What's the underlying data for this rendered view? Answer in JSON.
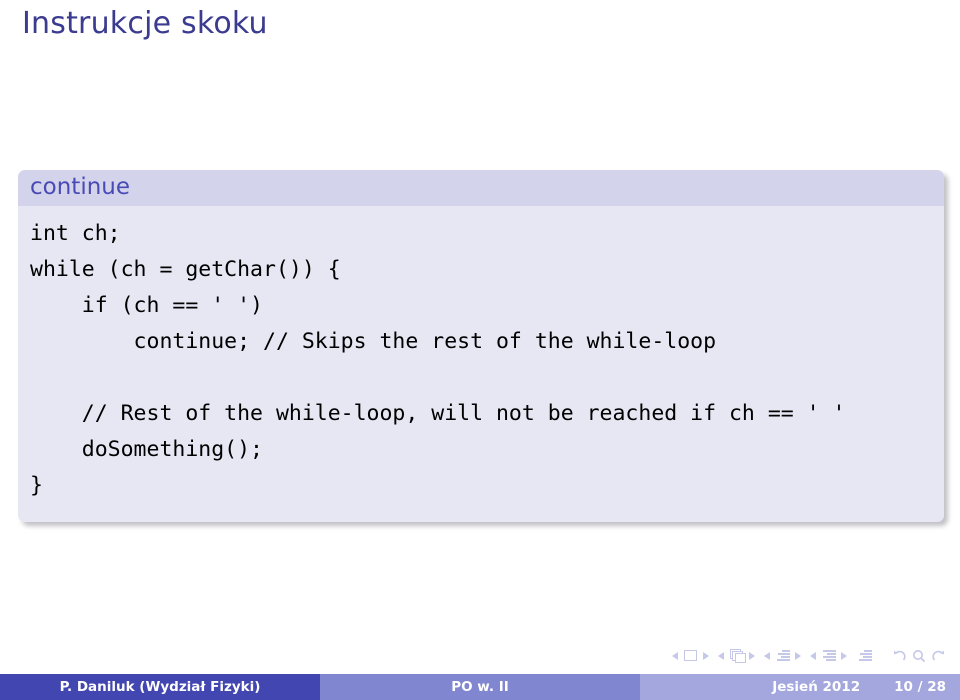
{
  "slide": {
    "title": "Instrukcje skoku",
    "title_color": "#3b3b8f"
  },
  "code_block": {
    "header": "continue",
    "header_bg": "#d3d3ec",
    "body_bg": "#e7e7f4",
    "header_color": "#4a4ab5",
    "lines": [
      "int ch;",
      "while (ch = getChar()) {",
      "    if (ch == ' ')",
      "        continue; // Skips the rest of the while-loop",
      "",
      "    // Rest of the while-loop, will not be reached if ch == ' '",
      "    doSomething();",
      "}"
    ]
  },
  "navigation": {
    "items": [
      {
        "name": "slide-nav",
        "glyph": "square"
      },
      {
        "name": "frame-nav",
        "glyph": "frames"
      },
      {
        "name": "subsection-nav",
        "glyph": "lines"
      },
      {
        "name": "section-nav",
        "glyph": "lines-section"
      },
      {
        "name": "presentation-nav",
        "glyph": "lines-plain"
      }
    ],
    "tools": [
      "back-icon",
      "search-icon",
      "forward-icon"
    ]
  },
  "footer": {
    "author": "P. Daniluk  (Wydział Fizyki)",
    "course": "PO w. II",
    "term": "Jesień 2012",
    "page": "10 / 28",
    "author_bg": "#4246b0",
    "center_bg": "#8186d0",
    "right_bg": "#a3a7de"
  }
}
